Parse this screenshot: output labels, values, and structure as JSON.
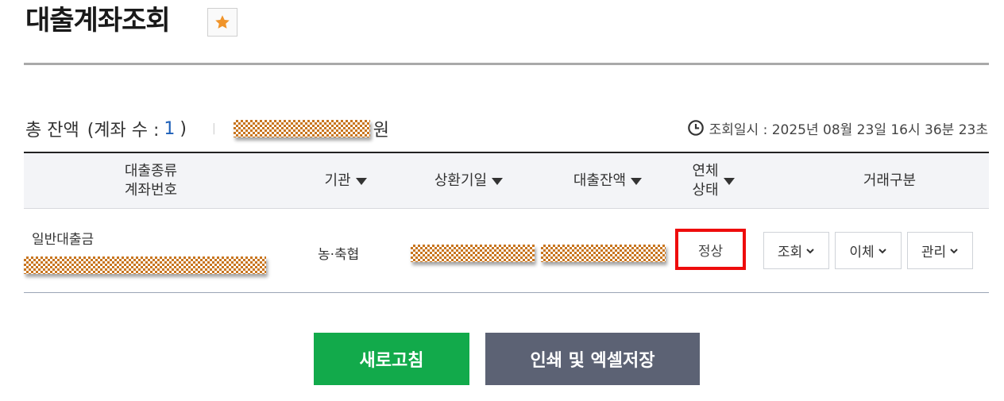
{
  "page": {
    "title": "대출계좌조회"
  },
  "summary": {
    "label": "총 잔액",
    "open_paren": "(계좌 수 :",
    "count": "1",
    "close_paren": ")",
    "separator": "|",
    "unit": "원"
  },
  "query_time": {
    "label": "조회일시 : 2025년 08월 23일 16시 36분 23초",
    "icon": "clock-icon"
  },
  "table": {
    "headers": {
      "type_line1": "대출종류",
      "type_line2": "계좌번호",
      "institution": "기관",
      "repay_day": "상환기일",
      "balance": "대출잔액",
      "overdue_line1": "연체",
      "overdue_line2": "상태",
      "transaction": "거래구분"
    },
    "rows": [
      {
        "loan_type": "일반대출금",
        "institution": "농·축협",
        "status": "정상",
        "actions": [
          "조회",
          "이체",
          "관리"
        ]
      }
    ]
  },
  "buttons": {
    "refresh": "새로고침",
    "print": "인쇄 및 엑셀저장"
  },
  "colors": {
    "refresh_bg": "#12aa4b",
    "print_bg": "#5c6274",
    "highlight": "#ee0c0c",
    "count": "#1d5fb8",
    "star": "#f0942a"
  }
}
